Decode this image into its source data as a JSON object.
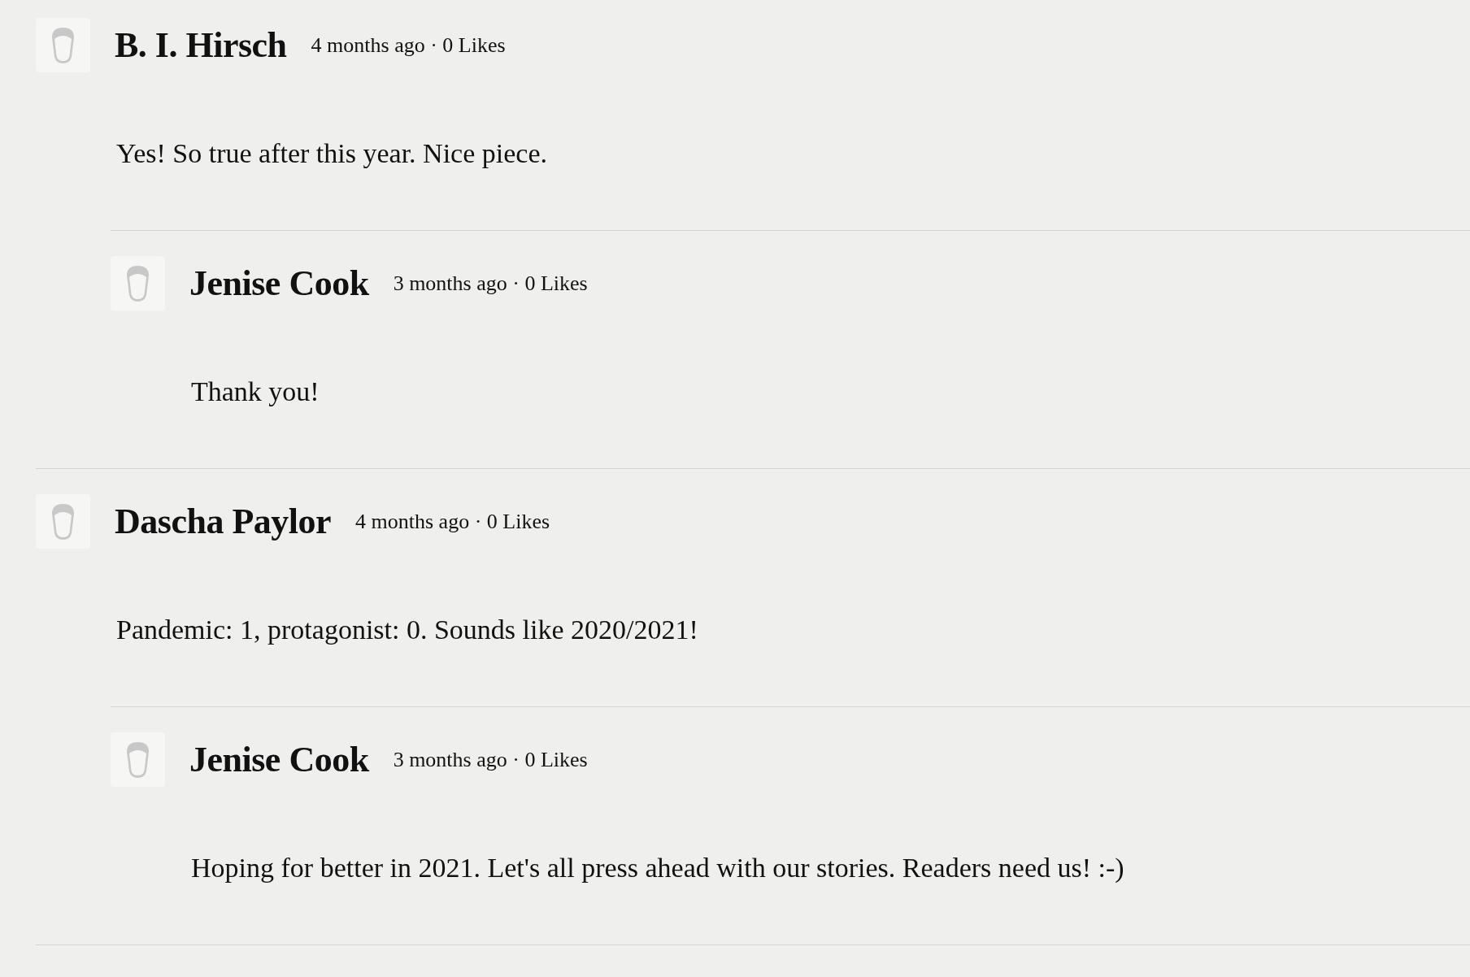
{
  "comments": [
    {
      "author": "B. I. Hirsch",
      "meta": "4 months ago · 0 Likes",
      "text": "Yes! So true after this year. Nice piece.",
      "replies": [
        {
          "author": "Jenise Cook",
          "meta": "3 months ago · 0 Likes",
          "text": "Thank you!"
        }
      ]
    },
    {
      "author": "Dascha Paylor",
      "meta": "4 months ago · 0 Likes",
      "text": "Pandemic: 1, protagonist: 0. Sounds like 2020/2021!",
      "replies": [
        {
          "author": "Jenise Cook",
          "meta": "3 months ago · 0 Likes",
          "text": "Hoping for better in 2021. Let's all press ahead with our stories. Readers need us! :-)"
        }
      ]
    }
  ]
}
